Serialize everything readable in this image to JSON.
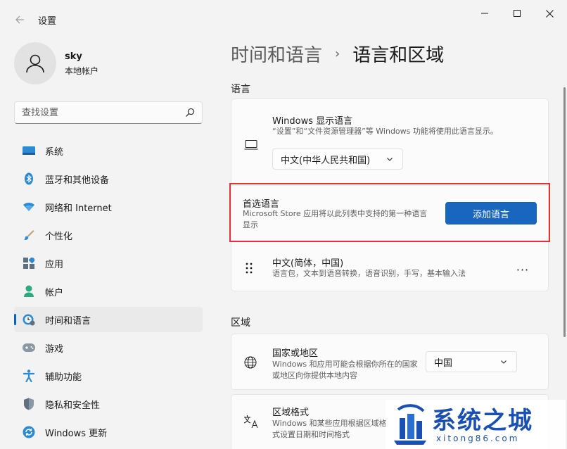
{
  "window": {
    "title": "设置",
    "back_icon": "back-arrow-icon"
  },
  "profile": {
    "name": "sky",
    "account_type": "本地帐户"
  },
  "search": {
    "placeholder": "查找设置"
  },
  "sidebar": {
    "items": [
      {
        "label": "系统",
        "icon": "system-icon"
      },
      {
        "label": "蓝牙和其他设备",
        "icon": "bluetooth-icon"
      },
      {
        "label": "网络和 Internet",
        "icon": "network-icon"
      },
      {
        "label": "个性化",
        "icon": "brush-icon"
      },
      {
        "label": "应用",
        "icon": "apps-icon"
      },
      {
        "label": "帐户",
        "icon": "account-icon"
      },
      {
        "label": "时间和语言",
        "icon": "time-language-icon",
        "active": true
      },
      {
        "label": "游戏",
        "icon": "gaming-icon"
      },
      {
        "label": "辅助功能",
        "icon": "accessibility-icon"
      },
      {
        "label": "隐私和安全性",
        "icon": "shield-icon"
      },
      {
        "label": "Windows 更新",
        "icon": "update-icon"
      }
    ]
  },
  "breadcrumb": {
    "parent": "时间和语言",
    "separator": "›",
    "current": "语言和区域"
  },
  "language_section": {
    "label": "语言",
    "display_language": {
      "title": "Windows 显示语言",
      "description": "“设置”和“文件资源管理器”等 Windows 功能将使用此语言显示。",
      "selected": "中文(中华人民共和国)"
    },
    "preferred": {
      "title": "首选语言",
      "description": "Microsoft Store 应用将以此列表中支持的第一种语言显示",
      "button_label": "添加语言"
    },
    "installed_language": {
      "title": "中文(简体，中国)",
      "description": "语言包，文本到语音转换，语音识别，手写，基本输入法",
      "more_label": "···"
    }
  },
  "region_section": {
    "label": "区域",
    "country": {
      "title": "国家或地区",
      "description": "Windows 和应用可能会根据你所在的国家或地区向你提供本地内容",
      "selected": "中国"
    },
    "format": {
      "title": "区域格式",
      "description": "Windows 和某些应用根据区域格式设置日期和时间格式"
    }
  },
  "watermark": {
    "text": "系统之城",
    "url": "xitong86.com"
  },
  "colors": {
    "accent": "#0067c0",
    "button": "#1966c0",
    "highlight": "#e8322f"
  }
}
